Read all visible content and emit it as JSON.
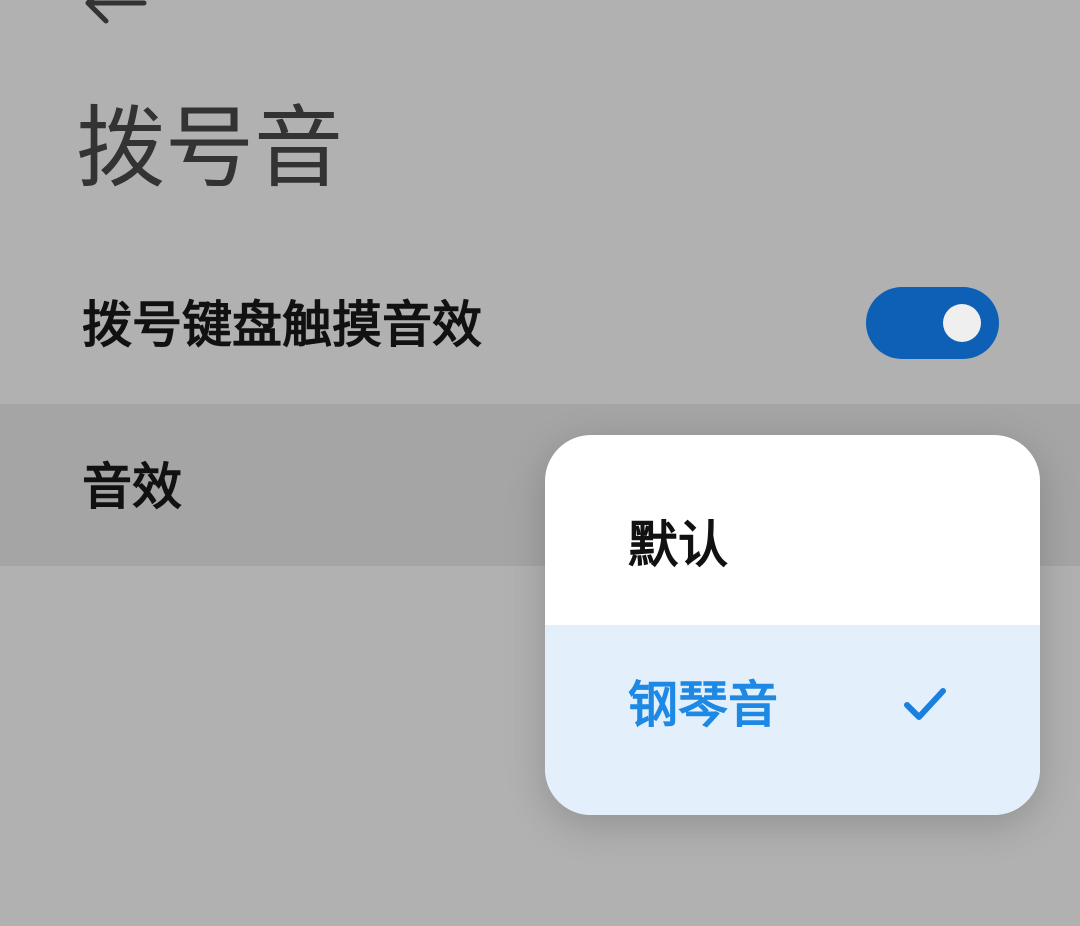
{
  "header": {
    "back_icon": "back-arrow-icon",
    "title": "拨号音"
  },
  "settings": {
    "keypad_touch_sound": {
      "label": "拨号键盘触摸音效",
      "enabled": true
    },
    "sound_effect": {
      "label": "音效"
    }
  },
  "popup_menu": {
    "options": [
      {
        "label": "默认",
        "selected": false
      },
      {
        "label": "钢琴音",
        "selected": true
      }
    ],
    "check_icon": "check-icon"
  },
  "colors": {
    "background_dim": "#b1b1b1",
    "highlighted_row": "#a5a5a5",
    "toggle_on": "#0e5fb6",
    "selected_option_bg": "#e3f0fc",
    "selected_option_text": "#1e88e5"
  }
}
